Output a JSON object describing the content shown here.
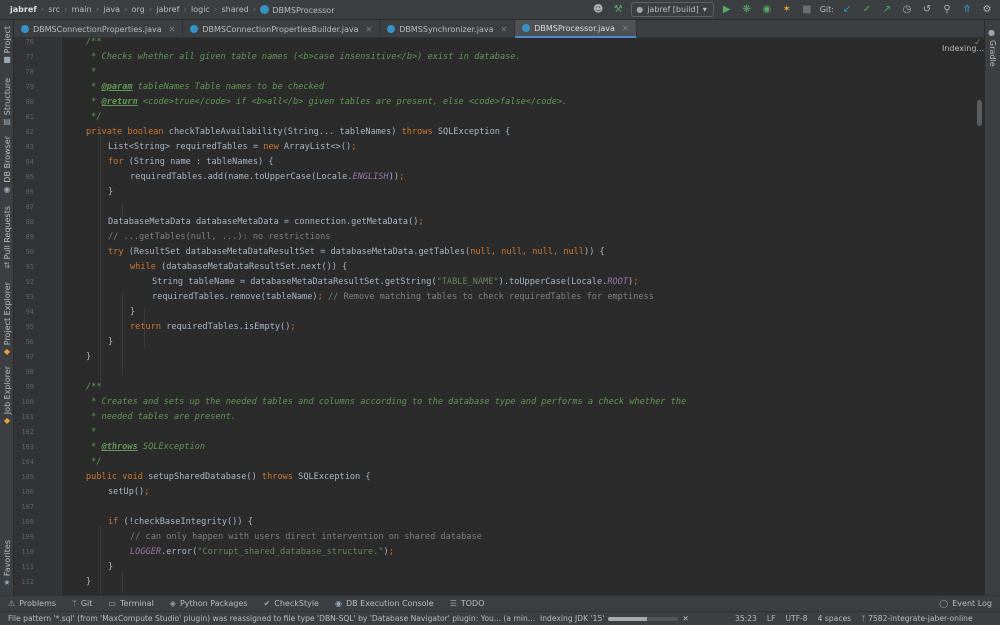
{
  "breadcrumbs": [
    "jabref",
    "src",
    "main",
    "java",
    "org",
    "jabref",
    "logic",
    "shared",
    "DBMSProcessor"
  ],
  "toolbar": {
    "run_config": "jabref [build]",
    "git_label": "Git:"
  },
  "tabs": [
    {
      "label": "DBMSConnectionProperties.java",
      "active": false
    },
    {
      "label": "DBMSConnectionPropertiesBuilder.java",
      "active": false
    },
    {
      "label": "DBMSSynchronizer.java",
      "active": false
    },
    {
      "label": "DBMSProcessor.java",
      "active": true
    }
  ],
  "left_tool_windows": [
    "Project",
    "Structure",
    "DB Browser",
    "Pull Requests",
    "Project Explorer",
    "Job Explorer",
    "Favorites"
  ],
  "right_tool_windows": [
    "Gradle"
  ],
  "editor": {
    "indexing_label": "Indexing...",
    "lines": [
      {
        "n": "76",
        "indent": 0,
        "tokens": [
          {
            "t": "/**",
            "c": "doc"
          }
        ]
      },
      {
        "n": "77",
        "indent": 0,
        "tokens": [
          {
            "t": " * Checks whether all given table names (",
            "c": "doc"
          },
          {
            "t": "<b>",
            "c": "doc"
          },
          {
            "t": "case insensitive",
            "c": "doc"
          },
          {
            "t": "</b>",
            "c": "doc"
          },
          {
            "t": ") exist in database.",
            "c": "doc"
          }
        ]
      },
      {
        "n": "78",
        "indent": 0,
        "tokens": [
          {
            "t": " *",
            "c": "doc"
          }
        ]
      },
      {
        "n": "79",
        "indent": 0,
        "tokens": [
          {
            "t": " * ",
            "c": "doc"
          },
          {
            "t": "@param",
            "c": "tag"
          },
          {
            "t": " tableNames Table names to be checked",
            "c": "doc"
          }
        ]
      },
      {
        "n": "80",
        "indent": 0,
        "tokens": [
          {
            "t": " * ",
            "c": "doc"
          },
          {
            "t": "@return",
            "c": "tag"
          },
          {
            "t": " <code>true</code> if <b>all</b> given tables are present, else <code>false</code>.",
            "c": "doc"
          }
        ]
      },
      {
        "n": "81",
        "indent": 0,
        "tokens": [
          {
            "t": " */",
            "c": "doc"
          }
        ]
      },
      {
        "n": "82",
        "indent": 0,
        "tokens": [
          {
            "t": "private boolean ",
            "c": "kw"
          },
          {
            "t": "checkTableAvailability(String... tableNames) ",
            "c": "pl"
          },
          {
            "t": "throws ",
            "c": "kw"
          },
          {
            "t": "SQLException {",
            "c": "pl"
          }
        ]
      },
      {
        "n": "83",
        "indent": 1,
        "tokens": [
          {
            "t": "List<String> requiredTables = ",
            "c": "pl"
          },
          {
            "t": "new ",
            "c": "kw"
          },
          {
            "t": "ArrayList<>()",
            "c": "pl"
          },
          {
            "t": ";",
            "c": "kw"
          }
        ]
      },
      {
        "n": "84",
        "indent": 1,
        "tokens": [
          {
            "t": "for ",
            "c": "kw"
          },
          {
            "t": "(String name : tableNames) {",
            "c": "pl"
          }
        ]
      },
      {
        "n": "85",
        "indent": 2,
        "tokens": [
          {
            "t": "requiredTables.add(name.toUpperCase(Locale.",
            "c": "pl"
          },
          {
            "t": "ENGLISH",
            "c": "fld"
          },
          {
            "t": "))",
            "c": "pl"
          },
          {
            "t": ";",
            "c": "kw"
          }
        ]
      },
      {
        "n": "86",
        "indent": 1,
        "tokens": [
          {
            "t": "}",
            "c": "pl"
          }
        ]
      },
      {
        "n": "87",
        "indent": 0,
        "tokens": []
      },
      {
        "n": "88",
        "indent": 1,
        "tokens": [
          {
            "t": "DatabaseMetaData databaseMetaData = connection.getMetaData()",
            "c": "pl"
          },
          {
            "t": ";",
            "c": "kw"
          }
        ]
      },
      {
        "n": "89",
        "indent": 1,
        "tokens": [
          {
            "t": "// ...getTables(null, ...): no restrictions",
            "c": "com"
          }
        ]
      },
      {
        "n": "90",
        "indent": 1,
        "tokens": [
          {
            "t": "try ",
            "c": "kw"
          },
          {
            "t": "(ResultSet databaseMetaDataResultSet = databaseMetaData.getTables(",
            "c": "pl"
          },
          {
            "t": "null, null, null, null",
            "c": "kw"
          },
          {
            "t": ")) {",
            "c": "pl"
          }
        ]
      },
      {
        "n": "91",
        "indent": 2,
        "tokens": [
          {
            "t": "while ",
            "c": "kw"
          },
          {
            "t": "(databaseMetaDataResultSet.next()) {",
            "c": "pl"
          }
        ]
      },
      {
        "n": "92",
        "indent": 3,
        "tokens": [
          {
            "t": "String tableName = databaseMetaDataResultSet.getString(",
            "c": "pl"
          },
          {
            "t": "\"TABLE_NAME\"",
            "c": "str"
          },
          {
            "t": ").toUpperCase(Locale.",
            "c": "pl"
          },
          {
            "t": "ROOT",
            "c": "fld"
          },
          {
            "t": ")",
            "c": "pl"
          },
          {
            "t": ";",
            "c": "kw"
          }
        ]
      },
      {
        "n": "93",
        "indent": 3,
        "tokens": [
          {
            "t": "requiredTables.remove(tableName)",
            "c": "pl"
          },
          {
            "t": "; ",
            "c": "kw"
          },
          {
            "t": "// Remove matching tables to check requiredTables for emptiness",
            "c": "com"
          }
        ]
      },
      {
        "n": "94",
        "indent": 2,
        "tokens": [
          {
            "t": "}",
            "c": "pl"
          }
        ]
      },
      {
        "n": "95",
        "indent": 2,
        "tokens": [
          {
            "t": "return ",
            "c": "kw"
          },
          {
            "t": "requiredTables.isEmpty()",
            "c": "pl"
          },
          {
            "t": ";",
            "c": "kw"
          }
        ]
      },
      {
        "n": "96",
        "indent": 1,
        "tokens": [
          {
            "t": "}",
            "c": "pl"
          }
        ]
      },
      {
        "n": "97",
        "indent": 0,
        "tokens": [
          {
            "t": "}",
            "c": "pl"
          }
        ]
      },
      {
        "n": "98",
        "indent": 0,
        "tokens": []
      },
      {
        "n": "99",
        "indent": 0,
        "tokens": [
          {
            "t": "/**",
            "c": "doc"
          }
        ]
      },
      {
        "n": "100",
        "indent": 0,
        "tokens": [
          {
            "t": " * Creates and sets up the needed tables and columns according to the database type and performs a check whether the",
            "c": "doc"
          }
        ]
      },
      {
        "n": "101",
        "indent": 0,
        "tokens": [
          {
            "t": " * needed tables are present.",
            "c": "doc"
          }
        ]
      },
      {
        "n": "102",
        "indent": 0,
        "tokens": [
          {
            "t": " *",
            "c": "doc"
          }
        ]
      },
      {
        "n": "103",
        "indent": 0,
        "tokens": [
          {
            "t": " * ",
            "c": "doc"
          },
          {
            "t": "@throws",
            "c": "tag"
          },
          {
            "t": " SQLException",
            "c": "doc"
          }
        ]
      },
      {
        "n": "104",
        "indent": 0,
        "tokens": [
          {
            "t": " */",
            "c": "doc"
          }
        ]
      },
      {
        "n": "105",
        "indent": 0,
        "tokens": [
          {
            "t": "public void ",
            "c": "kw"
          },
          {
            "t": "setupSharedDatabase() ",
            "c": "pl"
          },
          {
            "t": "throws ",
            "c": "kw"
          },
          {
            "t": "SQLException {",
            "c": "pl"
          }
        ]
      },
      {
        "n": "106",
        "indent": 1,
        "tokens": [
          {
            "t": "setUp()",
            "c": "pl"
          },
          {
            "t": ";",
            "c": "kw"
          }
        ]
      },
      {
        "n": "107",
        "indent": 0,
        "tokens": []
      },
      {
        "n": "108",
        "indent": 1,
        "tokens": [
          {
            "t": "if ",
            "c": "kw"
          },
          {
            "t": "(!checkBaseIntegrity()) {",
            "c": "pl"
          }
        ]
      },
      {
        "n": "109",
        "indent": 2,
        "tokens": [
          {
            "t": "// can only happen with users direct intervention on shared database",
            "c": "com"
          }
        ]
      },
      {
        "n": "110",
        "indent": 2,
        "tokens": [
          {
            "t": "LOGGER",
            "c": "fld"
          },
          {
            "t": ".error(",
            "c": "pl"
          },
          {
            "t": "\"Corrupt_shared_database_structure.\"",
            "c": "str"
          },
          {
            "t": ")",
            "c": "pl"
          },
          {
            "t": ";",
            "c": "kw"
          }
        ]
      },
      {
        "n": "111",
        "indent": 1,
        "tokens": [
          {
            "t": "}",
            "c": "pl"
          }
        ]
      },
      {
        "n": "112",
        "indent": 0,
        "tokens": [
          {
            "t": "}",
            "c": "pl"
          }
        ]
      }
    ]
  },
  "bottom_tools": [
    {
      "label": "Problems",
      "icon": "warning-icon"
    },
    {
      "label": "Git",
      "icon": "branch-icon"
    },
    {
      "label": "Terminal",
      "icon": "terminal-icon"
    },
    {
      "label": "Python Packages",
      "icon": "package-icon"
    },
    {
      "label": "CheckStyle",
      "icon": "checkstyle-icon"
    },
    {
      "label": "DB Execution Console",
      "icon": "database-icon"
    },
    {
      "label": "TODO",
      "icon": "list-icon"
    }
  ],
  "event_log": "Event Log",
  "status": {
    "message": "File pattern '*.sql' (from 'MaxCompute Studio' plugin) was reassigned to file type 'DBN-SQL' by 'Database Navigator' plugin: You... (a minute ago)",
    "indexing": "Indexing JDK '15'",
    "indexing_progress": 0.55,
    "position": "35:23",
    "line_sep": "LF",
    "encoding": "UTF-8",
    "indent": "4 spaces",
    "branch": "7582-integrate-jaber-online"
  },
  "colors": {
    "keyword": "#cc7832",
    "javadoc": "#629755",
    "string": "#6a8759",
    "comment": "#808080",
    "field": "#9876aa",
    "accent": "#4a88c7"
  }
}
